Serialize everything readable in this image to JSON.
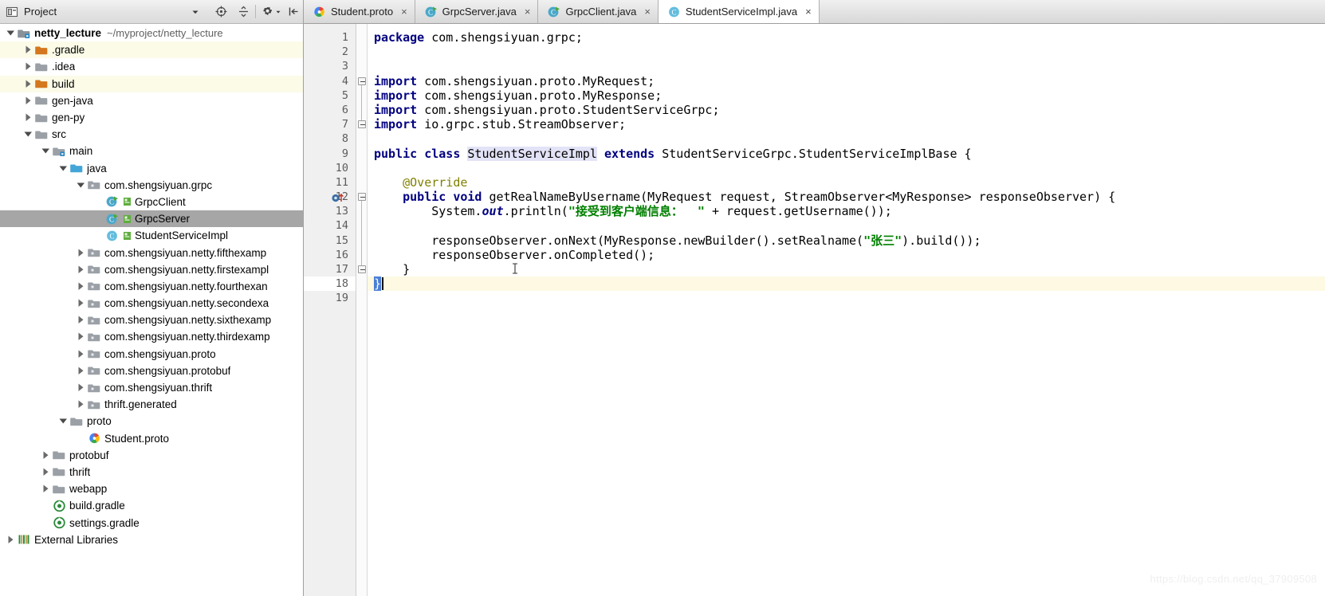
{
  "project_panel": {
    "title": "Project",
    "icons": [
      "project-view-icon",
      "chevron-down-icon",
      "locate-icon",
      "collapse-all-icon",
      "gear-icon",
      "hide-icon"
    ],
    "tree": [
      {
        "label": "netty_lecture",
        "path": "~/myproject/netty_lecture",
        "depth": 0,
        "twist": "down",
        "icon": "module-folder",
        "bold": true,
        "style": "plain"
      },
      {
        "label": ".gradle",
        "path": "",
        "depth": 1,
        "twist": "right",
        "icon": "folder-orange",
        "bold": false,
        "style": "alt"
      },
      {
        "label": ".idea",
        "path": "",
        "depth": 1,
        "twist": "right",
        "icon": "folder-gray",
        "bold": false,
        "style": "plain"
      },
      {
        "label": "build",
        "path": "",
        "depth": 1,
        "twist": "right",
        "icon": "folder-orange",
        "bold": false,
        "style": "alt"
      },
      {
        "label": "gen-java",
        "path": "",
        "depth": 1,
        "twist": "right",
        "icon": "folder-gray",
        "bold": false,
        "style": "plain"
      },
      {
        "label": "gen-py",
        "path": "",
        "depth": 1,
        "twist": "right",
        "icon": "folder-gray",
        "bold": false,
        "style": "plain"
      },
      {
        "label": "src",
        "path": "",
        "depth": 1,
        "twist": "down",
        "icon": "folder-gray",
        "bold": false,
        "style": "plain"
      },
      {
        "label": "main",
        "path": "",
        "depth": 2,
        "twist": "down",
        "icon": "folder-module",
        "bold": false,
        "style": "plain"
      },
      {
        "label": "java",
        "path": "",
        "depth": 3,
        "twist": "down",
        "icon": "folder-source",
        "bold": false,
        "style": "plain"
      },
      {
        "label": "com.shengsiyuan.grpc",
        "path": "",
        "depth": 4,
        "twist": "down",
        "icon": "package",
        "bold": false,
        "style": "plain"
      },
      {
        "label": "GrpcClient",
        "path": "",
        "depth": 5,
        "twist": "none",
        "icon": "class-runnable",
        "bold": false,
        "style": "plain"
      },
      {
        "label": "GrpcServer",
        "path": "",
        "depth": 5,
        "twist": "none",
        "icon": "class-runnable",
        "bold": false,
        "style": "sel"
      },
      {
        "label": "StudentServiceImpl",
        "path": "",
        "depth": 5,
        "twist": "none",
        "icon": "class",
        "bold": false,
        "style": "plain"
      },
      {
        "label": "com.shengsiyuan.netty.fifthexamp",
        "path": "",
        "depth": 4,
        "twist": "right",
        "icon": "package",
        "bold": false,
        "style": "plain"
      },
      {
        "label": "com.shengsiyuan.netty.firstexampl",
        "path": "",
        "depth": 4,
        "twist": "right",
        "icon": "package",
        "bold": false,
        "style": "plain"
      },
      {
        "label": "com.shengsiyuan.netty.fourthexan",
        "path": "",
        "depth": 4,
        "twist": "right",
        "icon": "package",
        "bold": false,
        "style": "plain"
      },
      {
        "label": "com.shengsiyuan.netty.secondexa",
        "path": "",
        "depth": 4,
        "twist": "right",
        "icon": "package",
        "bold": false,
        "style": "plain"
      },
      {
        "label": "com.shengsiyuan.netty.sixthexamp",
        "path": "",
        "depth": 4,
        "twist": "right",
        "icon": "package",
        "bold": false,
        "style": "plain"
      },
      {
        "label": "com.shengsiyuan.netty.thirdexamp",
        "path": "",
        "depth": 4,
        "twist": "right",
        "icon": "package",
        "bold": false,
        "style": "plain"
      },
      {
        "label": "com.shengsiyuan.proto",
        "path": "",
        "depth": 4,
        "twist": "right",
        "icon": "package",
        "bold": false,
        "style": "plain"
      },
      {
        "label": "com.shengsiyuan.protobuf",
        "path": "",
        "depth": 4,
        "twist": "right",
        "icon": "package",
        "bold": false,
        "style": "plain"
      },
      {
        "label": "com.shengsiyuan.thrift",
        "path": "",
        "depth": 4,
        "twist": "right",
        "icon": "package",
        "bold": false,
        "style": "plain"
      },
      {
        "label": "thrift.generated",
        "path": "",
        "depth": 4,
        "twist": "right",
        "icon": "package",
        "bold": false,
        "style": "plain"
      },
      {
        "label": "proto",
        "path": "",
        "depth": 3,
        "twist": "down",
        "icon": "folder-gray",
        "bold": false,
        "style": "plain"
      },
      {
        "label": "Student.proto",
        "path": "",
        "depth": 4,
        "twist": "none",
        "icon": "proto-file",
        "bold": false,
        "style": "plain"
      },
      {
        "label": "protobuf",
        "path": "",
        "depth": 2,
        "twist": "right",
        "icon": "folder-gray",
        "bold": false,
        "style": "plain"
      },
      {
        "label": "thrift",
        "path": "",
        "depth": 2,
        "twist": "right",
        "icon": "folder-gray",
        "bold": false,
        "style": "plain"
      },
      {
        "label": "webapp",
        "path": "",
        "depth": 2,
        "twist": "right",
        "icon": "folder-gray",
        "bold": false,
        "style": "plain"
      },
      {
        "label": "build.gradle",
        "path": "",
        "depth": 2,
        "twist": "none",
        "icon": "gradle-file",
        "bold": false,
        "style": "plain"
      },
      {
        "label": "settings.gradle",
        "path": "",
        "depth": 2,
        "twist": "none",
        "icon": "gradle-file",
        "bold": false,
        "style": "plain"
      },
      {
        "label": "External Libraries",
        "path": "",
        "depth": 0,
        "twist": "right",
        "icon": "libraries",
        "bold": false,
        "style": "plain"
      }
    ]
  },
  "tabs": [
    {
      "label": "Student.proto",
      "icon": "proto-file-icon",
      "active": false,
      "close": "×"
    },
    {
      "label": "GrpcServer.java",
      "icon": "java-runnable-icon",
      "active": false,
      "close": "×"
    },
    {
      "label": "GrpcClient.java",
      "icon": "java-runnable-icon",
      "active": false,
      "close": "×"
    },
    {
      "label": "StudentServiceImpl.java",
      "icon": "java-class-icon",
      "active": true,
      "close": "×"
    }
  ],
  "editor": {
    "file": "StudentServiceImpl.java",
    "first_line": 1,
    "last_line": 19,
    "caret_line": 18,
    "line_numbers": [
      "1",
      "2",
      "3",
      "4",
      "5",
      "6",
      "7",
      "8",
      "9",
      "10",
      "11",
      "12",
      "13",
      "14",
      "15",
      "16",
      "17",
      "18",
      "19"
    ],
    "gutter_icons": [
      {
        "line": 12,
        "icon": "implementing-method-icon"
      }
    ],
    "fold_markers": [
      {
        "line": 4,
        "type": "collapse"
      },
      {
        "line": 7,
        "type": "collapse"
      },
      {
        "line": 12,
        "type": "collapse"
      },
      {
        "line": 17,
        "type": "collapse"
      }
    ],
    "lines": [
      {
        "n": 1,
        "text": "package com.shengsiyuan.grpc;"
      },
      {
        "n": 2,
        "text": ""
      },
      {
        "n": 3,
        "text": ""
      },
      {
        "n": 4,
        "text": "import com.shengsiyuan.proto.MyRequest;"
      },
      {
        "n": 5,
        "text": "import com.shengsiyuan.proto.MyResponse;"
      },
      {
        "n": 6,
        "text": "import com.shengsiyuan.proto.StudentServiceGrpc;"
      },
      {
        "n": 7,
        "text": "import io.grpc.stub.StreamObserver;"
      },
      {
        "n": 8,
        "text": ""
      },
      {
        "n": 9,
        "text": "public class StudentServiceImpl extends StudentServiceGrpc.StudentServiceImplBase {"
      },
      {
        "n": 10,
        "text": ""
      },
      {
        "n": 11,
        "text": "    @Override"
      },
      {
        "n": 12,
        "text": "    public void getRealNameByUsername(MyRequest request, StreamObserver<MyResponse> responseObserver) {"
      },
      {
        "n": 13,
        "text": "        System.out.println(\"接受到客户端信息：  \" + request.getUsername());"
      },
      {
        "n": 14,
        "text": ""
      },
      {
        "n": 15,
        "text": "        responseObserver.onNext(MyResponse.newBuilder().setRealname(\"张三\").build());"
      },
      {
        "n": 16,
        "text": "        responseObserver.onCompleted();"
      },
      {
        "n": 17,
        "text": "    }"
      },
      {
        "n": 18,
        "text": "}"
      },
      {
        "n": 19,
        "text": ""
      }
    ],
    "highlighted_identifier": "StudentServiceImpl",
    "selected_brace": "}",
    "strings": [
      "接受到客户端信息：  ",
      "张三"
    ],
    "keywords": [
      "package",
      "import",
      "public",
      "class",
      "extends",
      "void"
    ],
    "annotation": "@Override"
  },
  "watermark": {
    "text": "https://blog.csdn.net/qq_37909508"
  },
  "colors": {
    "keyword": "#000080",
    "string": "#008000",
    "annotation": "#808000",
    "identifier_highlight": "#e3e3f7",
    "caret_line": "#fdf9e2",
    "selection": "#4a7fd4",
    "tree_selection": "#a6a6a6",
    "tree_alt_row": "#fbfbe8",
    "gutter_bg": "#f0f0f0",
    "folder_orange": "#d4771e",
    "folder_gray": "#9aa0a6",
    "source_folder_blue": "#43a6d8"
  }
}
